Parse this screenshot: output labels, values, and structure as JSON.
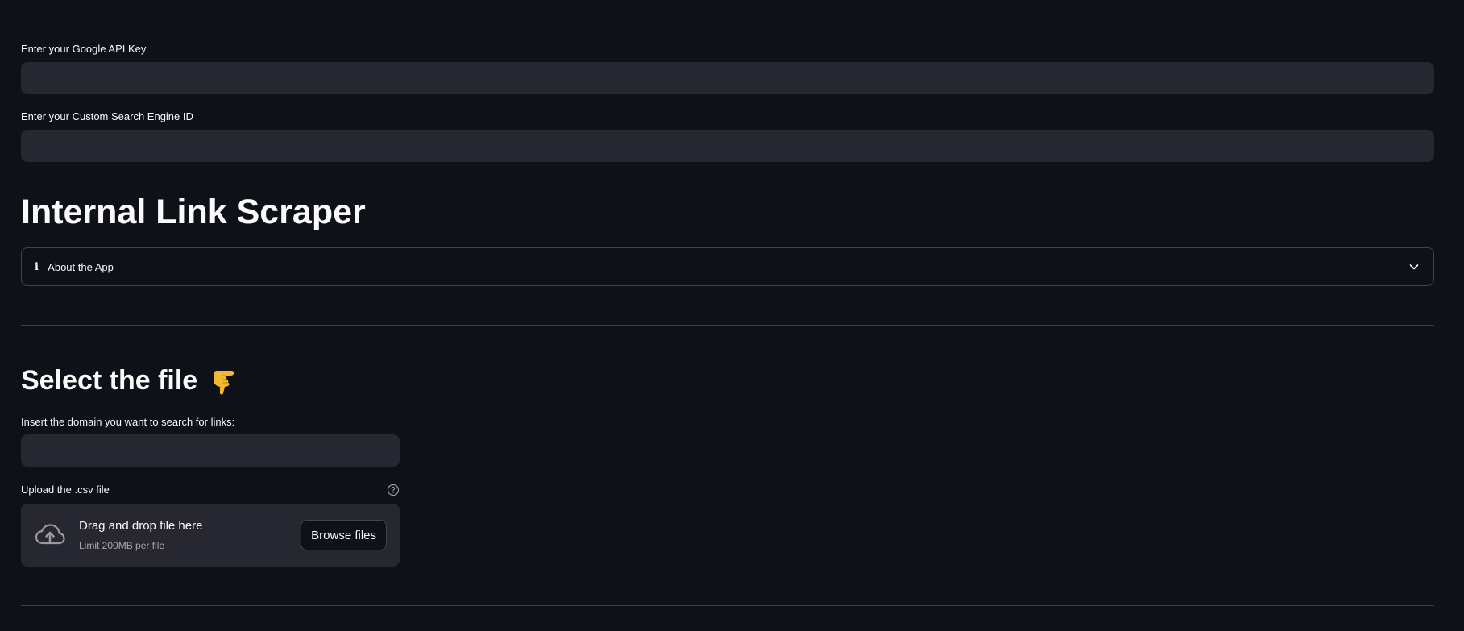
{
  "fields": {
    "api_key_label": "Enter your Google API Key",
    "api_key_value": "",
    "cse_id_label": "Enter your Custom Search Engine ID",
    "cse_id_value": ""
  },
  "header": {
    "title": "Internal Link Scraper"
  },
  "expander": {
    "icon": "info-icon",
    "icon_glyph": "ℹ",
    "label": " - About the App"
  },
  "select_section": {
    "title": "Select the file",
    "emoji_icon": "pointing-down-hand-icon",
    "domain_label": "Insert the domain you want to search for links:",
    "domain_value": "",
    "upload_label": "Upload the .csv file",
    "dropzone_title": "Drag and drop file here",
    "dropzone_limit": "Limit 200MB per file",
    "browse_label": "Browse files"
  },
  "colors": {
    "background": "#0e1117",
    "input_background": "#262730",
    "text": "#fafafa",
    "emoji": "#f5b731"
  }
}
